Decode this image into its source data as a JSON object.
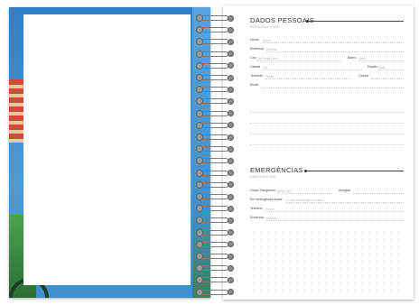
{
  "personal": {
    "title": "DADOS PESSOAIS",
    "subtitle": "PERSONAL DATA",
    "fields": [
      {
        "label": "Nome",
        "value": "Name"
      },
      {
        "label": "Endereço",
        "value": "Address"
      },
      {
        "label": "Cep",
        "value": "Zip/Postal Code"
      },
      {
        "label": "Bairro",
        "value": "Area"
      },
      {
        "label": "Cidade",
        "value": "City"
      },
      {
        "label": "Estado",
        "value": "State"
      },
      {
        "label": "Telefone",
        "value": "Phone"
      },
      {
        "label": "Celular",
        "value": ""
      },
      {
        "label": "Email",
        "value": ""
      }
    ]
  },
  "emergency": {
    "title": "EMERGÊNCIAS",
    "subtitle": "EMERGENCIES",
    "fields": [
      {
        "label": "Grupo Sanguíneo",
        "value": "Blood Type"
      },
      {
        "label": "Alergias",
        "value": ""
      },
      {
        "label": "Em emergência avisar",
        "value": "In case of emergency contact"
      },
      {
        "label": "Telefone",
        "value": "Phone"
      },
      {
        "label": "Endereço",
        "value": "Address"
      }
    ]
  }
}
